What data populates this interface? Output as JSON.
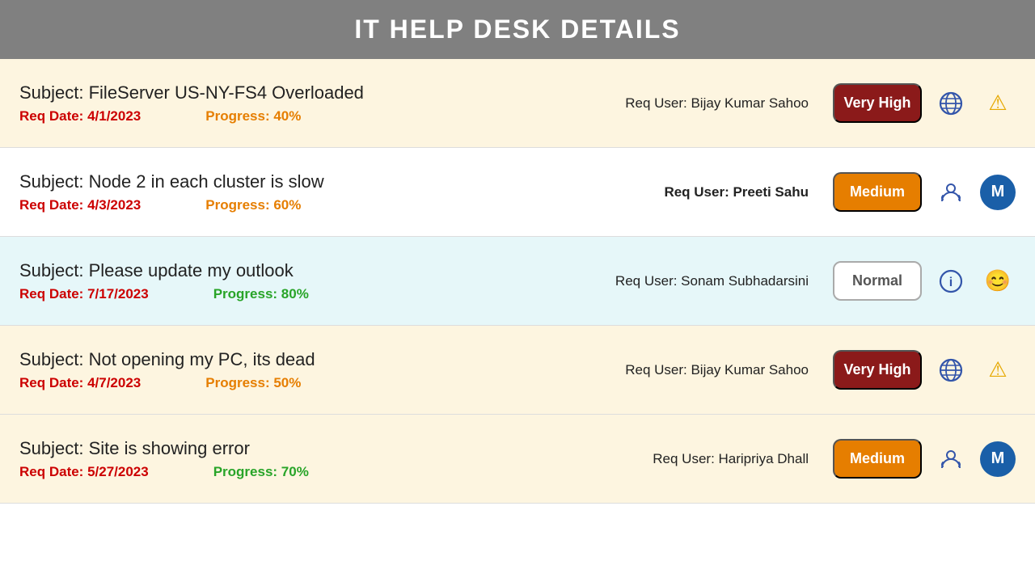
{
  "header": {
    "title": "IT HELP DESK DETAILS"
  },
  "tickets": [
    {
      "id": 1,
      "subject": "Subject: FileServer US-NY-FS4 Overloaded",
      "req_date_label": "Req Date: 4/1/2023",
      "progress_label": "Progress: 40%",
      "progress_class": "progress-orange",
      "req_user": "Req User: Bijay Kumar Sahoo",
      "req_user_bold": false,
      "priority": "Very High",
      "priority_class": "priority-very-high",
      "bg_class": "bg-beige",
      "icon1": "🌐",
      "icon1_name": "globe-icon",
      "icon2": "⚠️",
      "icon2_name": "warning-icon",
      "icon2_type": "warning",
      "icon3": null
    },
    {
      "id": 2,
      "subject": "Subject: Node 2 in each cluster is slow",
      "req_date_label": "Req Date: 4/3/2023",
      "progress_label": "Progress: 60%",
      "progress_class": "progress-orange",
      "req_user": "Req User: Preeti Sahu",
      "req_user_bold": true,
      "priority": "Medium",
      "priority_class": "priority-medium",
      "bg_class": "bg-white",
      "icon1": "🧑‍💼",
      "icon1_name": "support-icon",
      "icon2": "M",
      "icon2_name": "m-badge-icon",
      "icon2_type": "badge-m",
      "icon3": null
    },
    {
      "id": 3,
      "subject": "Subject: Please update my outlook",
      "req_date_label": "Req Date: 7/17/2023",
      "progress_label": "Progress: 80%",
      "progress_class": "progress-green",
      "req_user": "Req User: Sonam Subhadarsini",
      "req_user_bold": false,
      "priority": "Normal",
      "priority_class": "priority-normal",
      "bg_class": "bg-lightblue",
      "icon1": "ℹ️",
      "icon1_name": "info-icon",
      "icon2": "😊",
      "icon2_name": "smiley-icon",
      "icon2_type": "smiley",
      "icon3": null
    },
    {
      "id": 4,
      "subject": "Subject: Not opening my PC, its dead",
      "req_date_label": "Req Date: 4/7/2023",
      "progress_label": "Progress: 50%",
      "progress_class": "progress-orange",
      "req_user": "Req User: Bijay Kumar Sahoo",
      "req_user_bold": false,
      "priority": "Very High",
      "priority_class": "priority-very-high",
      "bg_class": "bg-beige",
      "icon1": "🌐",
      "icon1_name": "globe-icon-2",
      "icon2": "⚠️",
      "icon2_name": "warning-icon-2",
      "icon2_type": "warning",
      "icon3": null
    },
    {
      "id": 5,
      "subject": "Subject: Site is showing error",
      "req_date_label": "Req Date: 5/27/2023",
      "progress_label": "Progress: 70%",
      "progress_class": "progress-green",
      "req_user": "Req User: Haripriya Dhall",
      "req_user_bold": false,
      "priority": "Medium",
      "priority_class": "priority-medium",
      "bg_class": "bg-beige",
      "icon1": "🧑‍💼",
      "icon1_name": "support-icon-2",
      "icon2": "M",
      "icon2_name": "m-badge-icon-2",
      "icon2_type": "badge-m",
      "icon3": null
    }
  ]
}
